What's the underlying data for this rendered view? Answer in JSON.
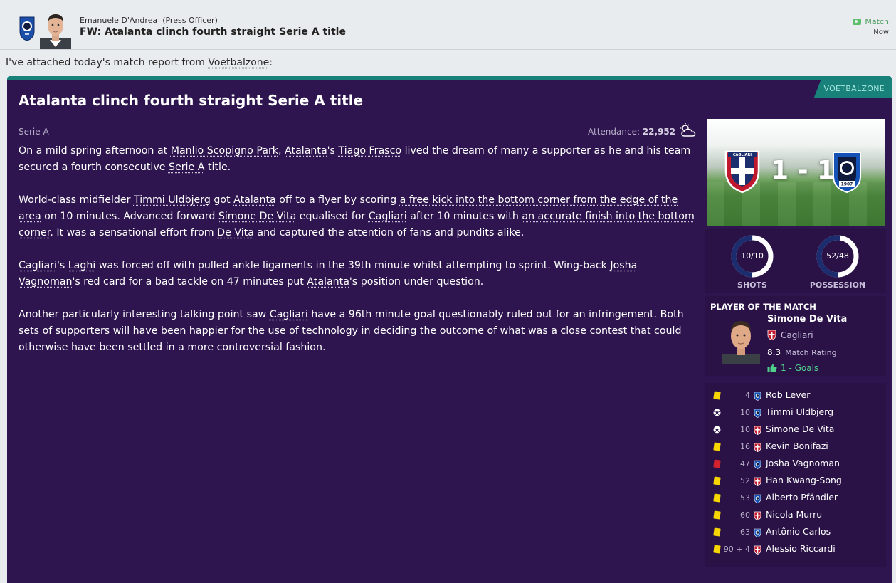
{
  "header": {
    "sender_name": "Emanuele D'Andrea",
    "sender_role": "(Press Officer)",
    "subject": "FW: Atalanta clinch fourth straight Serie A title",
    "tag": "Match",
    "time": "Now"
  },
  "intro": {
    "text": "I've attached today's match report from ",
    "link": "Voetbalzone",
    "suffix": ":"
  },
  "article": {
    "source": "VOETBALZONE",
    "title": "Atalanta clinch fourth straight Serie A title",
    "competition": "Serie A",
    "attendance_label": "Attendance:",
    "attendance_value": "22,952",
    "weather_icon": "partly-cloudy-icon",
    "paragraphs": [
      [
        {
          "t": "On a mild spring afternoon at "
        },
        {
          "t": "Manlio Scopigno Park",
          "link": true
        },
        {
          "t": ", "
        },
        {
          "t": "Atalanta",
          "link": true
        },
        {
          "t": "'s "
        },
        {
          "t": "Tiago Frasco",
          "link": true
        },
        {
          "t": " lived the dream of many a supporter as he and his team secured a fourth consecutive "
        },
        {
          "t": "Serie A",
          "link": true
        },
        {
          "t": " title."
        }
      ],
      [
        {
          "t": "World-class midfielder "
        },
        {
          "t": "Timmi Uldbjerg",
          "link": true
        },
        {
          "t": " got "
        },
        {
          "t": "Atalanta",
          "link": true
        },
        {
          "t": " off to a flyer by scoring "
        },
        {
          "t": "a free kick into the bottom corner from the edge of the area",
          "link": true
        },
        {
          "t": " on 10 minutes. Advanced forward "
        },
        {
          "t": "Simone De Vita",
          "link": true
        },
        {
          "t": " equalised for "
        },
        {
          "t": "Cagliari",
          "link": true
        },
        {
          "t": " after 10 minutes with "
        },
        {
          "t": "an accurate finish into the bottom corner",
          "link": true
        },
        {
          "t": ". It was a sensational effort from "
        },
        {
          "t": "De Vita",
          "link": true
        },
        {
          "t": " and captured the attention of fans and pundits alike."
        }
      ],
      [
        {
          "t": "Cagliari",
          "link": true
        },
        {
          "t": "'s "
        },
        {
          "t": "Laghi",
          "link": true
        },
        {
          "t": " was forced off with pulled ankle ligaments in the 39th minute whilst attempting to sprint. Wing-back "
        },
        {
          "t": "Josha Vagnoman",
          "link": true
        },
        {
          "t": "'s red card for a bad tackle on 47 minutes put "
        },
        {
          "t": "Atalanta",
          "link": true
        },
        {
          "t": "'s position under question."
        }
      ],
      [
        {
          "t": "Another particularly interesting talking point saw "
        },
        {
          "t": "Cagliari",
          "link": true
        },
        {
          "t": " have a 96th minute goal questionably ruled out for an infringement. Both sets of supporters will have been happier for the use of technology in deciding the outcome of what was a close contest that could otherwise have been settled in a more controversial fashion."
        }
      ]
    ]
  },
  "match": {
    "score": "1 - 1",
    "home_crest_text": "CAGLIARI",
    "away_crest_text": "1907",
    "stats": [
      {
        "name": "SHOTS",
        "value": "10/10",
        "fraction": 0.5
      },
      {
        "name": "POSSESSION",
        "value": "52/48",
        "fraction": 0.52
      }
    ]
  },
  "potm": {
    "title": "PLAYER OF THE MATCH",
    "name": "Simone De Vita",
    "club": "Cagliari",
    "rating": "8.3",
    "rating_label": "Match Rating",
    "goals": "1 - Goals"
  },
  "events": [
    {
      "icon": "yellow-card-icon",
      "minute": "4",
      "team": "atalanta",
      "player": "Rob Lever"
    },
    {
      "icon": "goal-ball-icon",
      "minute": "10",
      "team": "atalanta",
      "player": "Timmi Uldbjerg"
    },
    {
      "icon": "goal-ball-icon",
      "minute": "10",
      "team": "cagliari",
      "player": "Simone De Vita"
    },
    {
      "icon": "yellow-card-icon",
      "minute": "16",
      "team": "cagliari",
      "player": "Kevin Bonifazi"
    },
    {
      "icon": "red-card-icon",
      "minute": "47",
      "team": "atalanta",
      "player": "Josha Vagnoman"
    },
    {
      "icon": "yellow-card-icon",
      "minute": "52",
      "team": "cagliari",
      "player": "Han Kwang-Song"
    },
    {
      "icon": "yellow-card-icon",
      "minute": "53",
      "team": "atalanta",
      "player": "Alberto Pfändler"
    },
    {
      "icon": "yellow-card-icon",
      "minute": "60",
      "team": "cagliari",
      "player": "Nicola Murru"
    },
    {
      "icon": "yellow-card-icon",
      "minute": "63",
      "team": "atalanta",
      "player": "Antônio Carlos"
    },
    {
      "icon": "yellow-card-icon",
      "minute": "90 + 4",
      "team": "cagliari",
      "player": "Alessio Riccardi"
    }
  ],
  "colors": {
    "article_bg": "#2e154f",
    "accent": "#17817a",
    "yellow_card": "#f6d500",
    "red_card": "#d3222d",
    "ring_dark": "#1b2d6e",
    "ring_light": "#ffffff",
    "goal_green": "#4fd18b"
  }
}
